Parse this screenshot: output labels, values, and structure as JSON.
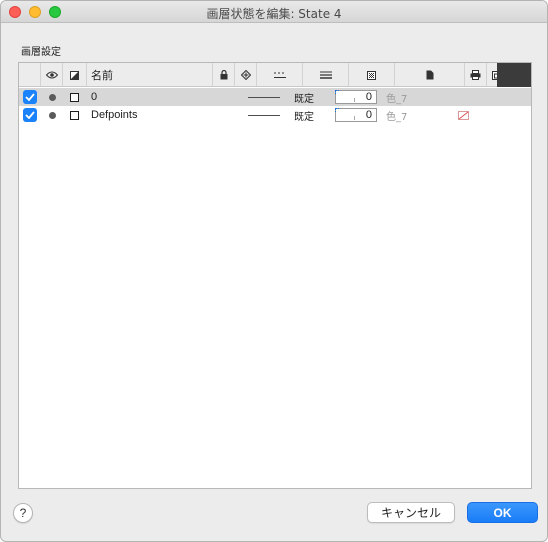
{
  "window": {
    "title": "画層状態を編集: State 4"
  },
  "section": {
    "label": "画層設定"
  },
  "table": {
    "header": {
      "name_label": "名前",
      "icons": [
        "eye-icon",
        "freeze-icon",
        "lock-icon",
        "plot-icon",
        "linetype-icon",
        "lineweight-icon",
        "transparency-icon",
        "plotstyle-icon",
        "printer-icon",
        "new-vp-freeze-icon"
      ]
    },
    "rows": [
      {
        "checked": true,
        "name": "0",
        "lineweight": "既定",
        "transparency": "0",
        "plot_style": "色_7",
        "selected": true
      },
      {
        "checked": true,
        "name": "Defpoints",
        "lineweight": "既定",
        "transparency": "0",
        "plot_style": "色_7",
        "selected": false
      }
    ]
  },
  "colors": {
    "accent": "#1a82fb",
    "selected_row": "#d7d7d7"
  },
  "footer": {
    "help_label": "?",
    "cancel_label": "キャンセル",
    "ok_label": "OK"
  }
}
